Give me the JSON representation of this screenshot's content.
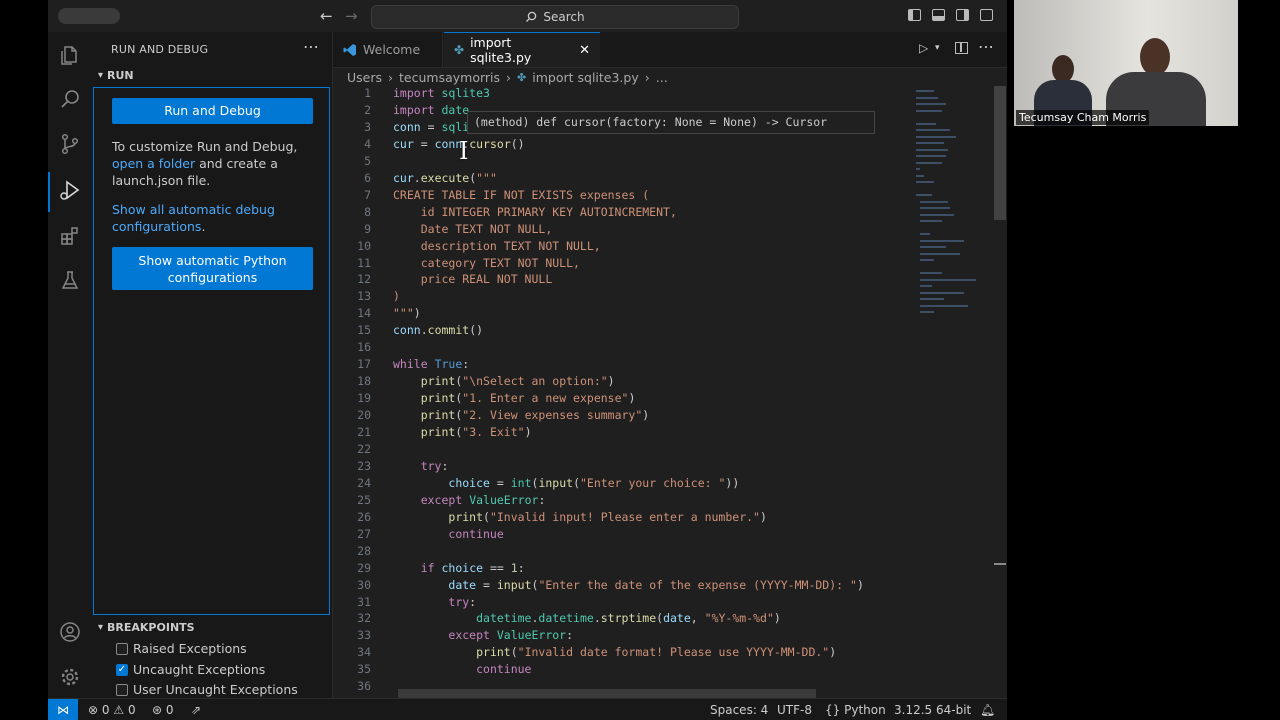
{
  "titlebar": {
    "search_label": "Search"
  },
  "sidebar": {
    "title": "RUN AND DEBUG",
    "run_section": "RUN",
    "run_button": "Run and Debug",
    "customize_text_before": "To customize Run and Debug, ",
    "customize_link": "open a folder",
    "customize_text_after": " and create a launch.json file.",
    "show_debug_link": "Show all automatic debug configurations",
    "show_debug_after": ".",
    "python_button": "Show automatic Python configurations",
    "breakpoints_title": "BREAKPOINTS",
    "breakpoints": [
      {
        "label": "Raised Exceptions",
        "checked": false
      },
      {
        "label": "Uncaught Exceptions",
        "checked": true
      },
      {
        "label": "User Uncaught Exceptions",
        "checked": false
      }
    ]
  },
  "tabs": [
    {
      "label": "Welcome",
      "active": false
    },
    {
      "label": "import sqlite3.py",
      "active": true
    }
  ],
  "breadcrumb": {
    "folder1": "Users",
    "folder2": "tecumsaymorris",
    "file": "import sqlite3.py",
    "tail": "..."
  },
  "hover_text": "(method) def cursor(factory: None = None) -> Cursor",
  "code": [
    {
      "n": "1",
      "html": "<span class='kw'>import</span> <span class='cl'>sqlite3</span>"
    },
    {
      "n": "2",
      "html": "<span class='kw'>import</span> <span class='cl'>date</span>"
    },
    {
      "n": "3",
      "html": "<span class='vr'>conn</span> = <span class='cl'>sqli</span>"
    },
    {
      "n": "4",
      "html": "<span class='vr'>cur</span> = <span class='vr'>conn</span>.<span class='fn'>cursor</span>()"
    },
    {
      "n": "5",
      "html": ""
    },
    {
      "n": "6",
      "html": "<span class='vr'>cur</span>.<span class='fn'>execute</span>(<span class='st'>\"\"\"</span>"
    },
    {
      "n": "7",
      "html": "<span class='st'>CREATE TABLE IF NOT EXISTS expenses (</span>"
    },
    {
      "n": "8",
      "html": "<span class='st'>    id INTEGER PRIMARY KEY AUTOINCREMENT,</span>"
    },
    {
      "n": "9",
      "html": "<span class='st'>    Date TEXT NOT NULL,</span>"
    },
    {
      "n": "10",
      "html": "<span class='st'>    description TEXT NOT NULL,</span>"
    },
    {
      "n": "11",
      "html": "<span class='st'>    category TEXT NOT NULL,</span>"
    },
    {
      "n": "12",
      "html": "<span class='st'>    price REAL NOT NULL</span>"
    },
    {
      "n": "13",
      "html": "<span class='st'>)</span>"
    },
    {
      "n": "14",
      "html": "<span class='st'>\"\"\"</span>)"
    },
    {
      "n": "15",
      "html": "<span class='vr'>conn</span>.<span class='fn'>commit</span>()"
    },
    {
      "n": "16",
      "html": ""
    },
    {
      "n": "17",
      "html": "<span class='kw'>while</span> <span class='kb'>True</span>:"
    },
    {
      "n": "18",
      "html": "    <span class='fn'>print</span>(<span class='st'>\"\\nSelect an option:\"</span>)"
    },
    {
      "n": "19",
      "html": "    <span class='fn'>print</span>(<span class='st'>\"1. Enter a new expense\"</span>)"
    },
    {
      "n": "20",
      "html": "    <span class='fn'>print</span>(<span class='st'>\"2. View expenses summary\"</span>)"
    },
    {
      "n": "21",
      "html": "    <span class='fn'>print</span>(<span class='st'>\"3. Exit\"</span>)"
    },
    {
      "n": "22",
      "html": ""
    },
    {
      "n": "23",
      "html": "    <span class='kw'>try</span>:"
    },
    {
      "n": "24",
      "html": "        <span class='vr'>choice</span> = <span class='cl'>int</span>(<span class='fn'>input</span>(<span class='st'>\"Enter your choice: \"</span>))"
    },
    {
      "n": "25",
      "html": "    <span class='kw'>except</span> <span class='cl'>ValueError</span>:"
    },
    {
      "n": "26",
      "html": "        <span class='fn'>print</span>(<span class='st'>\"Invalid input! Please enter a number.\"</span>)"
    },
    {
      "n": "27",
      "html": "        <span class='kw'>continue</span>"
    },
    {
      "n": "28",
      "html": ""
    },
    {
      "n": "29",
      "html": "    <span class='kw'>if</span> <span class='vr'>choice</span> == <span class='nm'>1</span>:"
    },
    {
      "n": "30",
      "html": "        <span class='vr'>date</span> = <span class='fn'>input</span>(<span class='st'>\"Enter the date of the expense (YYYY-MM-DD): \"</span>)"
    },
    {
      "n": "31",
      "html": "        <span class='kw'>try</span>:"
    },
    {
      "n": "32",
      "html": "            <span class='cl'>datetime</span>.<span class='cl'>datetime</span>.<span class='fn'>strptime</span>(<span class='vr'>date</span>, <span class='st'>\"%Y-%m-%d\"</span>)"
    },
    {
      "n": "33",
      "html": "        <span class='kw'>except</span> <span class='cl'>ValueError</span>:"
    },
    {
      "n": "34",
      "html": "            <span class='fn'>print</span>(<span class='st'>\"Invalid date format! Please use YYYY-MM-DD.\"</span>)"
    },
    {
      "n": "35",
      "html": "            <span class='kw'>continue</span>"
    },
    {
      "n": "36",
      "html": ""
    }
  ],
  "statusbar": {
    "errors": "0",
    "warnings": "0",
    "ports": "0",
    "spaces": "Spaces: 4",
    "encoding": "UTF-8",
    "language": "Python",
    "interpreter": "3.12.5 64-bit"
  },
  "video": {
    "name": "Tecumsay Cham Morris"
  },
  "colors": {
    "accent": "#0078d4",
    "background": "#1f1f1f",
    "sidebar": "#181818"
  },
  "icons": [
    "explorer-icon",
    "search-icon",
    "source-control-icon",
    "run-debug-icon",
    "extensions-icon",
    "testing-icon",
    "account-icon",
    "settings-gear-icon"
  ]
}
